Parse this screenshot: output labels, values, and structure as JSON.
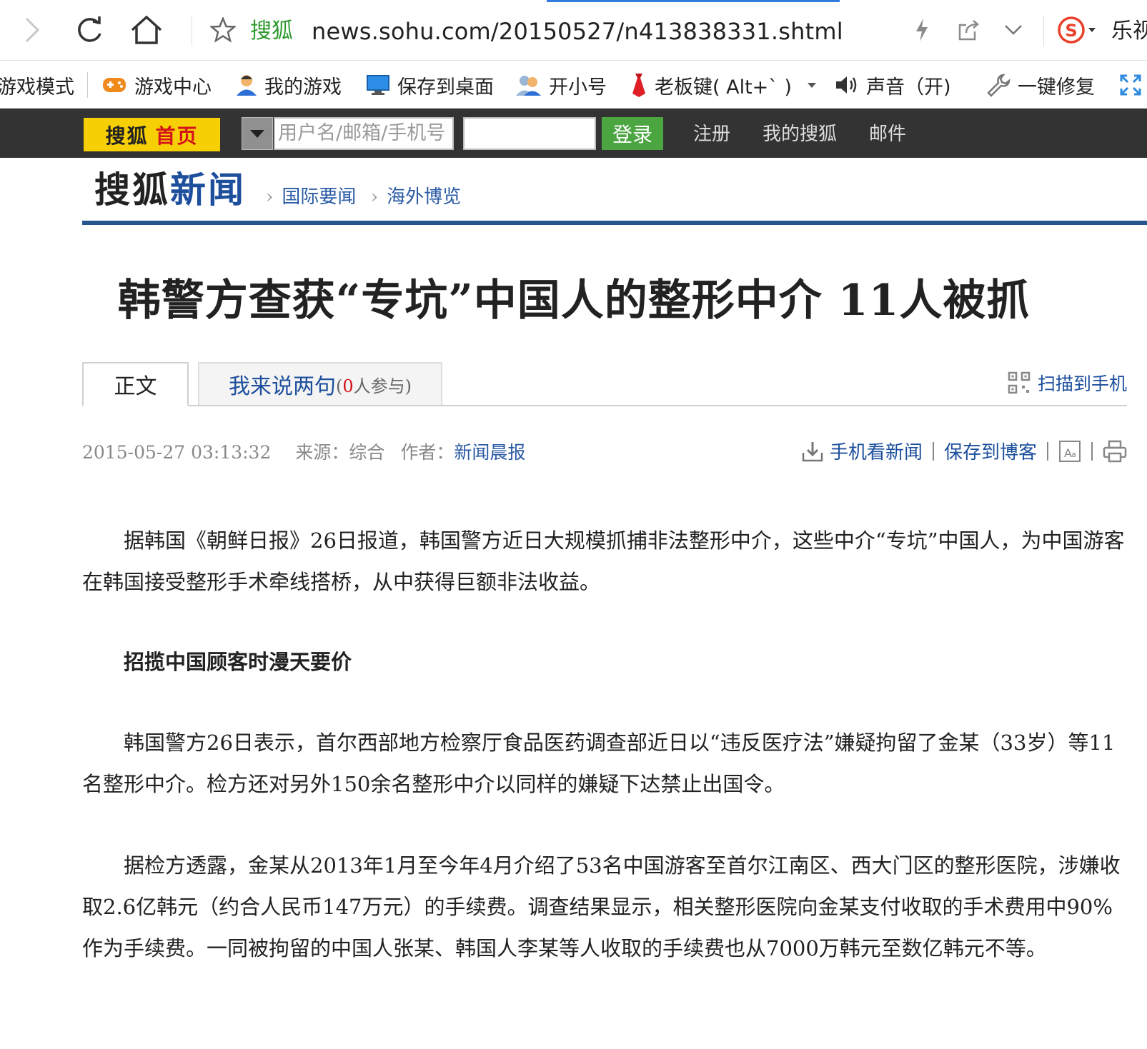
{
  "browser": {
    "site_name": "搜狐",
    "url": "news.sohu.com/20150527/n413838331.shtml",
    "right_text": "乐视",
    "progress_color": "#2f7be0"
  },
  "game_toolbar": {
    "mode": "游戏模式",
    "center": "游戏中心",
    "my_games": "我的游戏",
    "save_desktop": "保存到桌面",
    "small_account": "开小号",
    "boss_key": "老板键( Alt+` )",
    "sound": "声音（开)",
    "repair": "一键修复"
  },
  "sohu_bar": {
    "logo_a": "搜狐",
    "logo_b": "首页",
    "username_placeholder": "用户名/邮箱/手机号",
    "login": "登录",
    "register": "注册",
    "my_sohu": "我的搜狐",
    "mail": "邮件"
  },
  "channel": {
    "logo_a": "搜狐",
    "logo_b": "新闻",
    "crumbs": [
      "国际要闻",
      "海外博览"
    ]
  },
  "article": {
    "title": "韩警方查获“专坑”中国人的整形中介  11人被抓",
    "tab_body": "正文",
    "tab_comment": "我来说两句",
    "tab_comment_open": "(",
    "tab_comment_count": "0",
    "tab_comment_suffix": "人参与)",
    "scan_to_phone": "扫描到手机",
    "datetime": "2015-05-27 03:13:32",
    "source_label": "来源：",
    "source": "综合",
    "author_label": "作者：",
    "author": "新闻晨报",
    "tool_mobile": "手机看新闻",
    "tool_blog": "保存到博客",
    "paragraphs": [
      "据韩国《朝鲜日报》26日报道，韩国警方近日大规模抓捕非法整形中介，这些中介“专坑”中国人，为中国游客在韩国接受整形手术牵线搭桥，从中获得巨额非法收益。",
      "韩国警方26日表示，首尔西部地方检察厅食品医药调查部近日以“违反医疗法”嫌疑拘留了金某（33岁）等11名整形中介。检方还对另外150余名整形中介以同样的嫌疑下达禁止出国令。",
      "据检方透露，金某从2013年1月至今年4月介绍了53名中国游客至首尔江南区、西大门区的整形医院，涉嫌收取2.6亿韩元（约合人民币147万元）的手续费。调查结果显示，相关整形医院向金某支付收取的手术费用中90%作为手续费。一同被拘留的中国人张某、韩国人李某等人收取的手续费也从7000万韩元至数亿韩元不等。"
    ],
    "subheading": "招揽中国顾客时漫天要价"
  },
  "colors": {
    "sohu_bar_bg": "#333333",
    "logo_yellow": "#f6cf05",
    "login_green": "#4ba541",
    "link_blue": "#1d4f9d",
    "channel_rule": "#27568f"
  }
}
